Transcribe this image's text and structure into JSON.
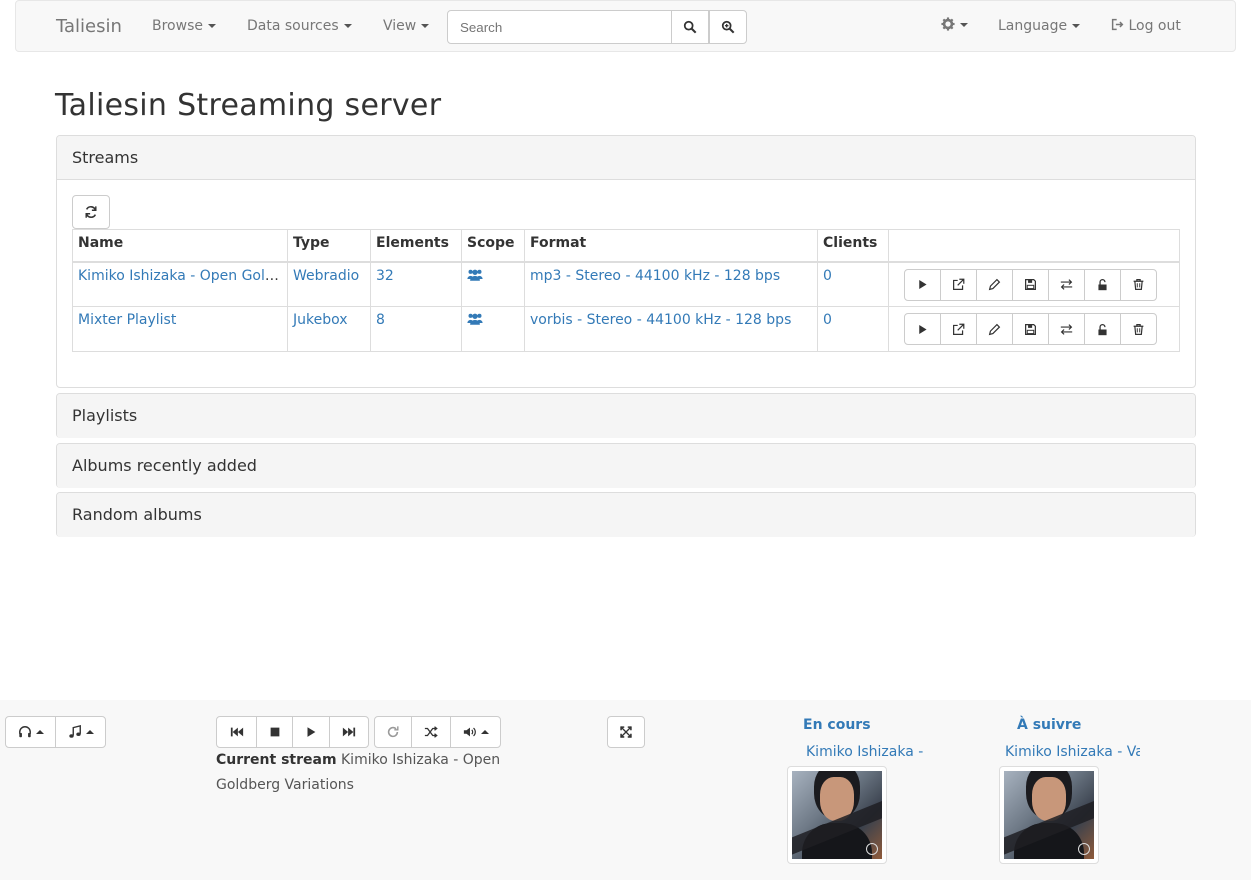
{
  "navbar": {
    "brand": "Taliesin",
    "browse": "Browse",
    "data_sources": "Data sources",
    "view": "View",
    "search_placeholder": "Search",
    "language": "Language",
    "logout": "Log out"
  },
  "page_title": "Taliesin Streaming server",
  "streams": {
    "heading": "Streams",
    "columns": [
      "Name",
      "Type",
      "Elements",
      "Scope",
      "Format",
      "Clients"
    ],
    "rows": [
      {
        "name": "Kimiko Ishizaka - Open Goldberg Variations",
        "type": "Webradio",
        "elements": "32",
        "format": "mp3 - Stereo - 44100 kHz - 128 bps",
        "clients": "0"
      },
      {
        "name": "Mixter Playlist",
        "type": "Jukebox",
        "elements": "8",
        "format": "vorbis - Stereo - 44100 kHz - 128 bps",
        "clients": "0"
      }
    ]
  },
  "panels": {
    "playlists": "Playlists",
    "albums_recent": "Albums recently added",
    "random_albums": "Random albums"
  },
  "player": {
    "current_stream_label": "Current stream",
    "current_stream_name": "Kimiko Ishizaka - Open Goldberg Variations",
    "now_playing_title": "En cours",
    "now_playing_track": "Kimiko Ishizaka -",
    "next_title": "À suivre",
    "next_track": "Kimiko Ishizaka - Va"
  },
  "colors": {
    "link": "#337ab7",
    "navbar_bg": "#f8f8f8",
    "panel_heading_bg": "#f5f5f5"
  }
}
